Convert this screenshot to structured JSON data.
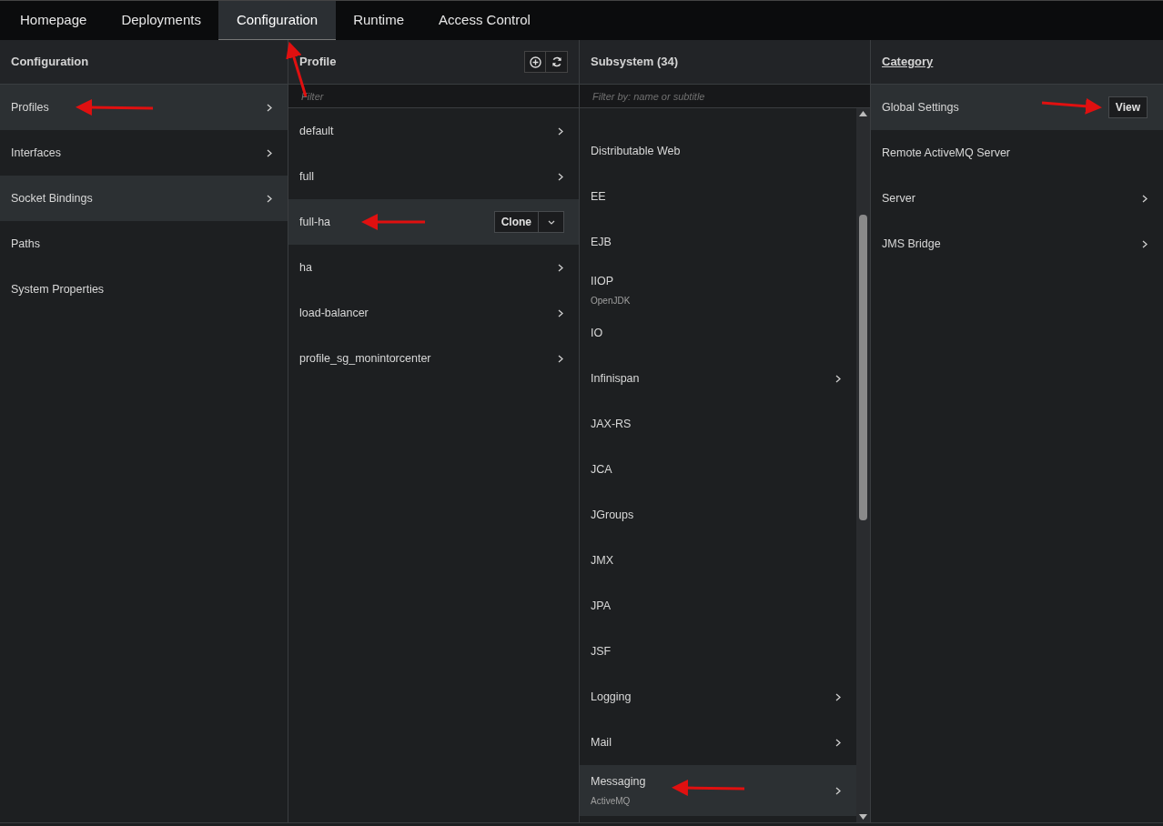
{
  "tabs": [
    {
      "label": "Homepage",
      "selected": false
    },
    {
      "label": "Deployments",
      "selected": false
    },
    {
      "label": "Configuration",
      "selected": true
    },
    {
      "label": "Runtime",
      "selected": false
    },
    {
      "label": "Access Control",
      "selected": false
    }
  ],
  "columns": [
    {
      "title": "Configuration",
      "items": [
        {
          "label": "Profiles",
          "selected": true,
          "chevron": true
        },
        {
          "label": "Interfaces",
          "selected": false,
          "chevron": true
        },
        {
          "label": "Socket Bindings",
          "selected": true,
          "chevron": true
        },
        {
          "label": "Paths",
          "selected": false,
          "chevron": false
        },
        {
          "label": "System Properties",
          "selected": false,
          "chevron": false
        }
      ]
    },
    {
      "title": "Profile",
      "placeholder": "Filter",
      "toolbar": true,
      "items": [
        {
          "label": "default",
          "selected": false,
          "chevron": true
        },
        {
          "label": "full",
          "selected": false,
          "chevron": true
        },
        {
          "label": "full-ha",
          "selected": true,
          "chevron": false,
          "action": "Clone"
        },
        {
          "label": "ha",
          "selected": false,
          "chevron": true
        },
        {
          "label": "load-balancer",
          "selected": false,
          "chevron": true
        },
        {
          "label": "profile_sg_monintorcenter",
          "selected": false,
          "chevron": true
        }
      ]
    },
    {
      "title": "Subsystem (34)",
      "placeholder": "Filter by: name or subtitle",
      "scrollable": true,
      "items": [
        {
          "label": "Distributable Web",
          "selected": false,
          "chevron": false
        },
        {
          "label": "EE",
          "selected": false,
          "chevron": false
        },
        {
          "label": "EJB",
          "selected": false,
          "chevron": false
        },
        {
          "label": "IIOP",
          "subtitle": "OpenJDK",
          "selected": false,
          "chevron": false
        },
        {
          "label": "IO",
          "selected": false,
          "chevron": false
        },
        {
          "label": "Infinispan",
          "selected": false,
          "chevron": true
        },
        {
          "label": "JAX-RS",
          "selected": false,
          "chevron": false
        },
        {
          "label": "JCA",
          "selected": false,
          "chevron": false
        },
        {
          "label": "JGroups",
          "selected": false,
          "chevron": false
        },
        {
          "label": "JMX",
          "selected": false,
          "chevron": false
        },
        {
          "label": "JPA",
          "selected": false,
          "chevron": false
        },
        {
          "label": "JSF",
          "selected": false,
          "chevron": false
        },
        {
          "label": "Logging",
          "selected": false,
          "chevron": true
        },
        {
          "label": "Mail",
          "selected": false,
          "chevron": true
        },
        {
          "label": "Messaging",
          "subtitle": "ActiveMQ",
          "selected": true,
          "chevron": true
        }
      ]
    },
    {
      "title": "Category",
      "title_underlined": true,
      "items": [
        {
          "label": "Global Settings",
          "selected": true,
          "chevron": false,
          "action": "View"
        },
        {
          "label": "Remote ActiveMQ Server",
          "selected": false,
          "chevron": false
        },
        {
          "label": "Server",
          "selected": false,
          "chevron": true
        },
        {
          "label": "JMS Bridge",
          "selected": false,
          "chevron": true
        }
      ]
    }
  ]
}
